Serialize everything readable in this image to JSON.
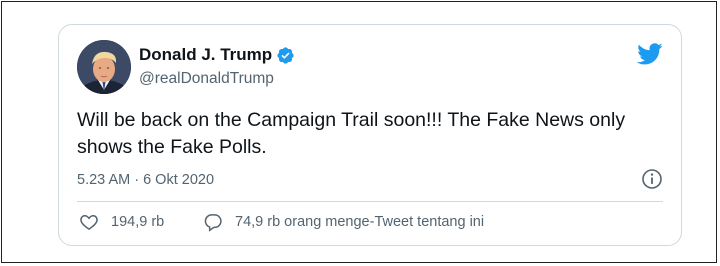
{
  "author": {
    "name": "Donald J. Trump",
    "handle": "@realDonaldTrump",
    "verified": true
  },
  "tweet": {
    "text": "Will be back on the Campaign Trail soon!!! The Fake News only shows the Fake Polls.",
    "timestamp": "5.23 AM · 6 Okt 2020"
  },
  "actions": {
    "likes": "194,9 rb",
    "conversation": "74,9 rb orang menge-Tweet tentang ini"
  },
  "colors": {
    "brand_blue": "#1d9bf0",
    "text_primary": "#0f1419",
    "text_secondary": "#536471",
    "border": "#cfd9de"
  },
  "icons": [
    "avatar",
    "verified-badge-icon",
    "twitter-bird-icon",
    "info-icon",
    "heart-icon",
    "speech-bubble-icon"
  ]
}
